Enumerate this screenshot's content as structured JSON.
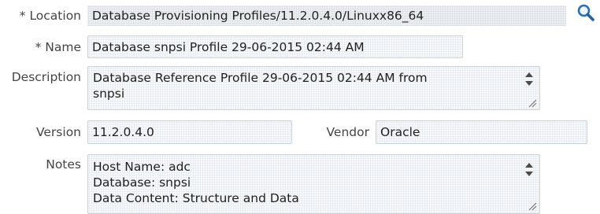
{
  "form": {
    "location": {
      "label": "* Location",
      "value": "Database Provisioning Profiles/11.2.0.4.0/Linuxx86_64"
    },
    "name": {
      "label": "* Name",
      "value": "Database snpsi  Profile 29-06-2015 02:44 AM"
    },
    "description": {
      "label": "Description",
      "lines": [
        "Database Reference Profile 29-06-2015 02:44 AM from",
        "snpsi"
      ]
    },
    "version": {
      "label": "Version",
      "value": "11.2.0.4.0"
    },
    "vendor": {
      "label": "Vendor",
      "value": "Oracle"
    },
    "notes": {
      "label": "Notes",
      "lines": [
        "Host Name: adc",
        "Database: snpsi",
        "Data Content: Structure and Data"
      ]
    }
  },
  "icons": {
    "search": "search-icon",
    "spinner": "spinner-arrows-icon",
    "resize": "resize-grip-icon"
  },
  "colors": {
    "search_icon": "#2e6fb0",
    "field_border": "#c9d3dc",
    "label_text": "#444444"
  }
}
